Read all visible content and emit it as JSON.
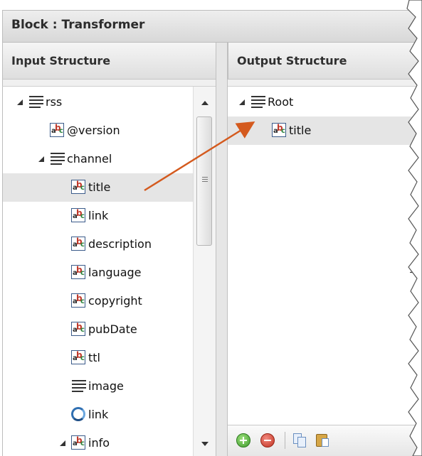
{
  "window": {
    "title": "Block : Transformer"
  },
  "input_structure": {
    "header": "Input Structure",
    "nodes": [
      {
        "label": "rss",
        "type": "structure",
        "toggle": "expanded",
        "depth": 0,
        "selected": false
      },
      {
        "label": "@version",
        "type": "string",
        "toggle": "none",
        "depth": 1,
        "selected": false
      },
      {
        "label": "channel",
        "type": "structure",
        "toggle": "expanded",
        "depth": 1,
        "selected": false
      },
      {
        "label": "title",
        "type": "string",
        "toggle": "none",
        "depth": 2,
        "selected": true
      },
      {
        "label": "link",
        "type": "string",
        "toggle": "none",
        "depth": 2,
        "selected": false
      },
      {
        "label": "description",
        "type": "string",
        "toggle": "none",
        "depth": 2,
        "selected": false
      },
      {
        "label": "language",
        "type": "string",
        "toggle": "none",
        "depth": 2,
        "selected": false
      },
      {
        "label": "copyright",
        "type": "string",
        "toggle": "none",
        "depth": 2,
        "selected": false
      },
      {
        "label": "pubDate",
        "type": "string",
        "toggle": "none",
        "depth": 2,
        "selected": false
      },
      {
        "label": "ttl",
        "type": "string",
        "toggle": "none",
        "depth": 2,
        "selected": false
      },
      {
        "label": "image",
        "type": "structure",
        "toggle": "collapsed",
        "depth": 2,
        "selected": false
      },
      {
        "label": "link",
        "type": "loop",
        "toggle": "collapsed",
        "depth": 2,
        "selected": false
      },
      {
        "label": "info",
        "type": "string",
        "toggle": "expanded",
        "depth": 2,
        "selected": false
      }
    ]
  },
  "output_structure": {
    "header": "Output Structure",
    "nodes": [
      {
        "label": "Root",
        "type": "structure",
        "toggle": "expanded",
        "depth": 0,
        "selected": false
      },
      {
        "label": "title",
        "type": "string",
        "toggle": "none",
        "depth": 1,
        "selected": true
      }
    ]
  },
  "footer_toolbar": {
    "buttons": [
      "add-icon",
      "remove-icon",
      "copy-icon",
      "paste-icon"
    ]
  },
  "mapping": {
    "from": "title",
    "to": "Root",
    "color": "#d45a1e"
  },
  "colors": {
    "selection": "#e5e5e5",
    "header_bg": "#dedede",
    "arrow": "#d45a1e"
  }
}
